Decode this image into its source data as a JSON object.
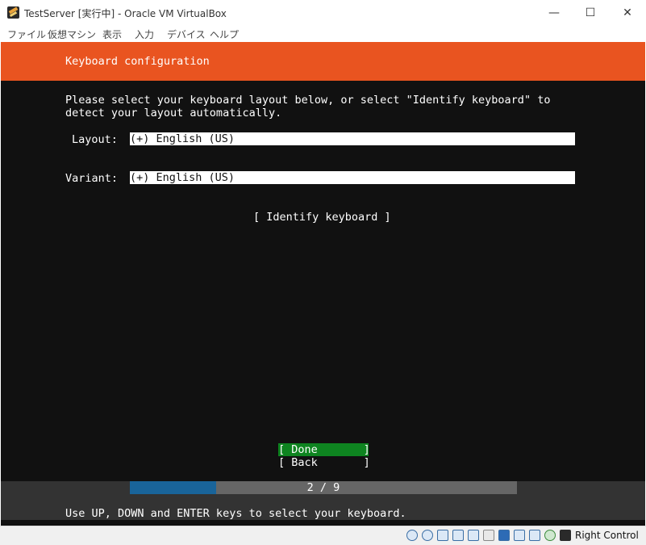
{
  "window": {
    "title": "TestServer [実行中] - Oracle VM VirtualBox",
    "minimize_glyph": "—",
    "maximize_glyph": "☐",
    "close_glyph": "✕"
  },
  "menu": [
    {
      "label": "ファイル"
    },
    {
      "label": "仮想マシン"
    },
    {
      "label": "表示"
    },
    {
      "label": "入力"
    },
    {
      "label": "デバイス"
    },
    {
      "label": "ヘルプ"
    }
  ],
  "installer": {
    "header_title": "Keyboard configuration",
    "instructions_line1": "Please select your keyboard layout below, or select \"Identify keyboard\" to",
    "instructions_line2": "detect your layout automatically.",
    "layout_label": "Layout:",
    "layout_value": "(+) English (US)",
    "variant_label": "Variant:",
    "variant_value": "(+) English (US)",
    "identify_button": "[ Identify keyboard ]",
    "done_button": "[ Done       ]",
    "back_button": "[ Back       ]",
    "progress": {
      "label": "2 / 9",
      "current": 2,
      "total": 9
    },
    "footer_hint": "Use UP, DOWN and ENTER keys to select your keyboard."
  },
  "statusbar": {
    "icons": [
      "hard-disk-icon",
      "optical-drive-icon",
      "audio-icon",
      "network-icon",
      "usb-icon",
      "shared-folder-icon",
      "display-icon",
      "video-capture-icon",
      "cpu-icon",
      "mouse-integration-icon",
      "keyboard-capture-icon"
    ],
    "host_key": "Right Control"
  },
  "colors": {
    "header": "#e95420",
    "done_button": "#0e8420",
    "progress_fill": "#19649a",
    "progress_track": "#666666",
    "background": "#111111"
  }
}
